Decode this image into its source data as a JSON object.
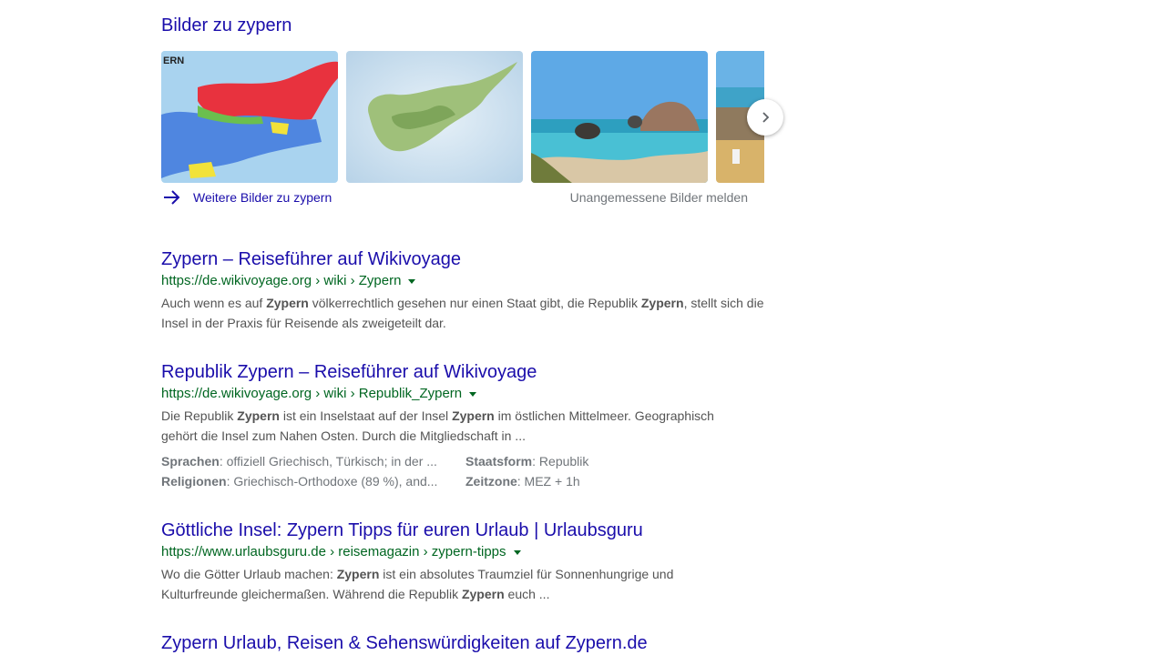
{
  "images": {
    "heading": "Bilder zu zypern",
    "thumb1_label": "ERN",
    "more_label": "Weitere Bilder zu zypern",
    "report_label": "Unangemessene Bilder melden"
  },
  "results": [
    {
      "title": "Zypern – Reiseführer auf Wikivoyage",
      "url": "https://de.wikivoyage.org › wiki › Zypern",
      "snippet": [
        {
          "t": "Auch wenn es auf "
        },
        {
          "b": "Zypern"
        },
        {
          "t": " völkerrechtlich gesehen nur einen Staat gibt, die Republik "
        },
        {
          "b": "Zypern"
        },
        {
          "t": ", stellt sich die Insel in der Praxis für Reisende als zweigeteilt dar."
        }
      ]
    },
    {
      "title": "Republik Zypern – Reiseführer auf Wikivoyage",
      "url": "https://de.wikivoyage.org › wiki › Republik_Zypern",
      "snippet": [
        {
          "t": "Die Republik "
        },
        {
          "b": "Zypern"
        },
        {
          "t": " ist ein Inselstaat auf der Insel "
        },
        {
          "b": "Zypern"
        },
        {
          "t": " im östlichen Mittelmeer. Geographisch gehört die Insel zum Nahen Osten. Durch die Mitgliedschaft in ..."
        }
      ],
      "facts": [
        {
          "key": "Sprachen",
          "value": ": offiziell Griechisch, Türkisch; in der ..."
        },
        {
          "key": "Staatsform",
          "value": ": Republik"
        },
        {
          "key": "Religionen",
          "value": ": Griechisch-Orthodoxe (89 %), and..."
        },
        {
          "key": "Zeitzone",
          "value": ": MEZ + 1h"
        }
      ]
    },
    {
      "title": "Göttliche Insel: Zypern Tipps für euren Urlaub | Urlaubsguru",
      "url": "https://www.urlaubsguru.de › reisemagazin › zypern-tipps",
      "snippet": [
        {
          "t": "Wo die Götter Urlaub machen: "
        },
        {
          "b": "Zypern"
        },
        {
          "t": " ist ein absolutes Traumziel für Sonnenhungrige und Kulturfreunde gleichermaßen. Während die Republik "
        },
        {
          "b": "Zypern"
        },
        {
          "t": " euch ..."
        }
      ]
    },
    {
      "title": "Zypern Urlaub, Reisen & Sehenswürdigkeiten auf Zypern.de"
    }
  ],
  "colors": {
    "link": "#1a0dab",
    "url": "#006621",
    "snippet": "#545454",
    "muted": "#70757a"
  },
  "icons": {
    "more": "arrow-right-icon",
    "next": "chevron-right-icon",
    "url_menu": "caret-down-icon"
  }
}
